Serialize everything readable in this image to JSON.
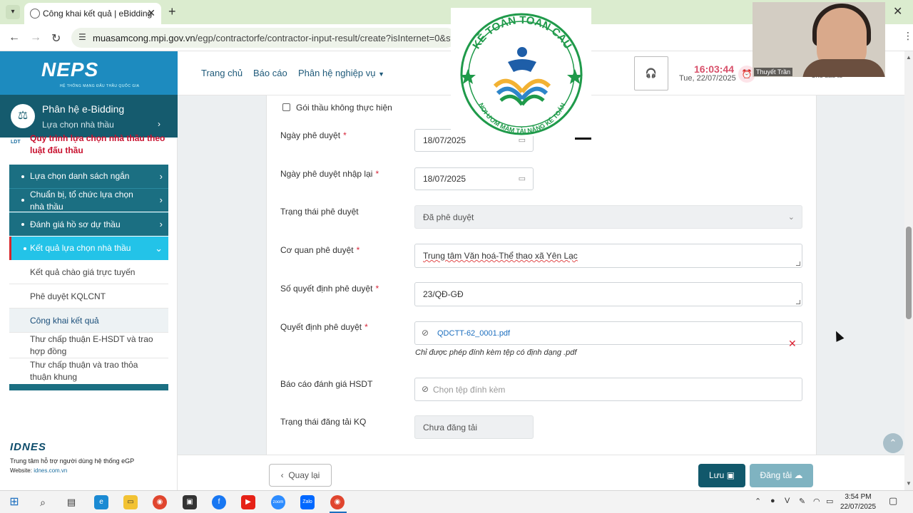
{
  "browser": {
    "tab_title": "Công khai kết quả | eBidding",
    "url_host": "muasamcong.mpi.gov.vn",
    "url_path": "/egp/contractorfe/contractor-input-result/create?isInternet=0&step=1&"
  },
  "brand": {
    "logo": "NEPS",
    "logo_sub": "HỆ THỐNG MẠNG ĐẤU THẦU QUỐC GIA"
  },
  "module": {
    "title": "Phân hệ e-Bidding",
    "subtitle": "Lựa chọn nhà thầu"
  },
  "sidebar": {
    "ldt_tag": "LDT",
    "ldt_text": "Quy trình lựa chọn nhà thầu theo luật đấu thầu",
    "items": [
      {
        "label": "Lựa chọn danh sách ngắn"
      },
      {
        "label": "Chuẩn bị, tổ chức lựa chọn nhà thầu"
      },
      {
        "label": "Đánh giá hồ sơ dự thầu"
      },
      {
        "label": "Kết quả lựa chọn nhà thầu"
      }
    ],
    "subitems": [
      {
        "label": "Kết quả chào giá trực tuyến"
      },
      {
        "label": "Phê duyệt KQLCNT"
      },
      {
        "label": "Công khai kết quả"
      },
      {
        "label": "Thư chấp thuận E-HSDT và trao hợp đồng"
      },
      {
        "label": "Thư chấp thuận và trao thỏa thuận khung"
      }
    ],
    "support_logo": "IDNES",
    "support_text": "Trung tâm hỗ trợ người dùng hệ thống eGP",
    "website_label": "Website:",
    "website": "idnes.com.vn"
  },
  "header": {
    "menu": [
      "Trang chủ",
      "Báo cáo",
      "Phân hệ nghiệp vụ"
    ],
    "time": "16:03:44",
    "date": "Tue, 22/07/2025",
    "investor": "Chủ đầu tư"
  },
  "form": {
    "checkbox_label": "Gói thầu không thực hiện",
    "approval_date_label": "Ngày phê duyệt",
    "approval_date": "18/07/2025",
    "reenter_date_label": "Ngày phê duyệt nhập lại",
    "reenter_date": "18/07/2025",
    "status_label": "Trạng thái phê duyệt",
    "status_value": "Đã phê duyệt",
    "agency_label": "Cơ quan phê duyệt",
    "agency_value": "Trung tâm Văn hoá-Thể thao xã Yên Lạc",
    "decision_no_label": "Số quyết định phê duyệt",
    "decision_no_value": "23/QĐ-GĐ",
    "decision_file_label": "Quyết định phê duyệt",
    "decision_file": "QDCTT-62_0001.pdf",
    "file_hint": "Chỉ được phép đính kèm tệp có định dạng .pdf",
    "report_label": "Báo cáo đánh giá HSDT",
    "report_placeholder": "Chọn tệp đính kèm",
    "publish_status_label": "Trạng thái đăng tải KQ",
    "publish_status_value": "Chưa đăng tải"
  },
  "footer": {
    "back": "Quay lại",
    "save": "Lưu",
    "publish": "Đăng tải"
  },
  "overlay": {
    "logo_top": "KẾ TOÁN TOÀN CẦU",
    "logo_bottom": "NƠI ƯƠM MẦM TÀI NĂNG KẾ TOÁN",
    "webcam_name": "Thuyết Trần"
  },
  "taskbar": {
    "time": "3:54 PM",
    "date": "22/07/2025"
  },
  "colors": {
    "brand": "#1d8bbf",
    "module": "#155b6e",
    "nav": "#1b6f82",
    "nav_active": "#23c3e8",
    "required": "#d6263a",
    "save": "#11586b"
  }
}
